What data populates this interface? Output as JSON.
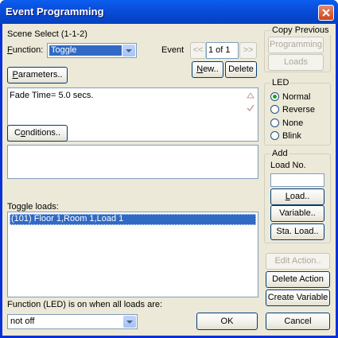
{
  "window": {
    "title": "Event Programming"
  },
  "scene_select": "Scene Select  (1-1-2)",
  "function": {
    "label_prefix": "",
    "label_ul": "F",
    "label_rest": "unction:",
    "value": "Toggle"
  },
  "event": {
    "label": "Event",
    "prev": "<<",
    "next": ">>",
    "counter": "1 of 1",
    "new_ul": "N",
    "new_rest": "ew..",
    "delete": "Delete"
  },
  "parameters": {
    "ul": "P",
    "rest": "arameters.."
  },
  "fade_text": "Fade Time= 5.0 secs.",
  "conditions": {
    "pre": "C",
    "ul": "o",
    "rest": "nditions.."
  },
  "toggle_loads": {
    "label": "Toggle loads:",
    "items": [
      "(101) Floor 1,Room 1,Load 1"
    ]
  },
  "function_led": {
    "label": "Function (LED) is on when all loads are:",
    "value": "not off"
  },
  "copy_previous": {
    "legend": "Copy Previous",
    "programming": "Programming",
    "loads": "Loads"
  },
  "led": {
    "legend": "LED",
    "options": [
      "Normal",
      "Reverse",
      "None",
      "Blink"
    ],
    "selected": "Normal"
  },
  "add": {
    "legend": "Add",
    "load_no": "Load No.",
    "load_no_ul": "o",
    "load_ul": "L",
    "load_rest": "oad..",
    "variable": "Variable..",
    "variable_ul": "V",
    "sta_load": "Sta. Load..",
    "sta_ul": "S"
  },
  "actions": {
    "edit": "Edit Action..",
    "delete": "Delete Action",
    "create": "Create Variable"
  },
  "footer": {
    "ok": "OK",
    "cancel": "Cancel"
  },
  "colors": {
    "title_bar": "#0b55e3",
    "face": "#ece9d8",
    "selection": "#316ac5"
  }
}
